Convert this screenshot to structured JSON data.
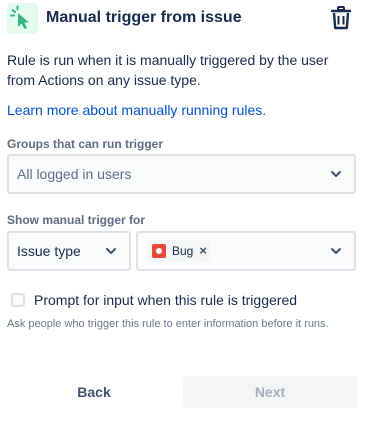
{
  "header": {
    "icon": "cursor-click-icon",
    "title": "Manual trigger from issue",
    "delete_icon": "trash-icon"
  },
  "description": "Rule is run when it is manually triggered by the user from Actions on any issue type.",
  "learn_more_link": "Learn more about manually running rules.",
  "groups_field": {
    "label": "Groups that can run trigger",
    "value": "All logged in users"
  },
  "show_for_field": {
    "label": "Show manual trigger for",
    "type_value": "Issue type",
    "selected_tags": [
      {
        "label": "Bug",
        "icon": "bug-icon",
        "remove": "×"
      }
    ]
  },
  "prompt_option": {
    "checked": false,
    "label": "Prompt for input when this rule is triggered",
    "helper": "Ask people who trigger this rule to enter information before it runs."
  },
  "footer": {
    "back_label": "Back",
    "next_label": "Next",
    "next_disabled": true
  },
  "colors": {
    "accent_green": "#36b37e",
    "link_blue": "#0052cc",
    "bug_red": "#e5493a"
  }
}
